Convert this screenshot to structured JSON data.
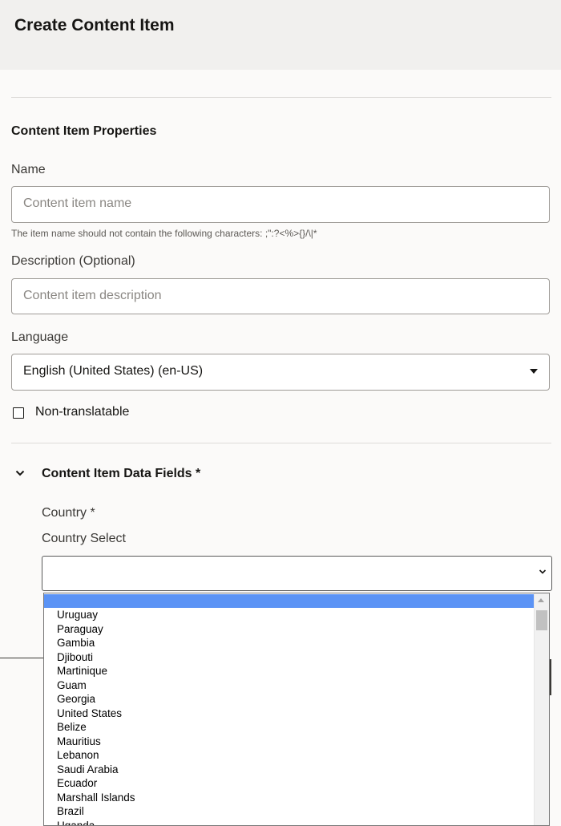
{
  "header": {
    "title": "Create Content Item"
  },
  "properties": {
    "section_title": "Content Item Properties",
    "name_label": "Name",
    "name_placeholder": "Content item name",
    "name_hint": "The item name should not contain the following characters: ;\":?<%>{}/\\|*",
    "description_label": "Description (Optional)",
    "description_placeholder": "Content item description",
    "language_label": "Language",
    "language_value": "English (United States) (en-US)",
    "non_translatable_label": "Non-translatable"
  },
  "data_fields": {
    "title": "Content Item Data Fields *",
    "country_label": "Country *",
    "country_select_label": "Country Select",
    "country_value": ""
  },
  "dropdown": {
    "selected": "",
    "options": [
      "Uruguay",
      "Paraguay",
      "Gambia",
      "Djibouti",
      "Martinique",
      "Guam",
      "Georgia",
      "United States",
      "Belize",
      "Mauritius",
      "Lebanon",
      "Saudi Arabia",
      "Ecuador",
      "Marshall Islands",
      "Brazil",
      "Uganda"
    ]
  },
  "icons": {
    "language_caret": "caret-down-icon",
    "section_toggle": "chevron-down-icon",
    "select_arrow": "chevron-down-icon"
  },
  "colors": {
    "highlight": "#5b93f5",
    "header_bg": "#f1f0ee"
  }
}
